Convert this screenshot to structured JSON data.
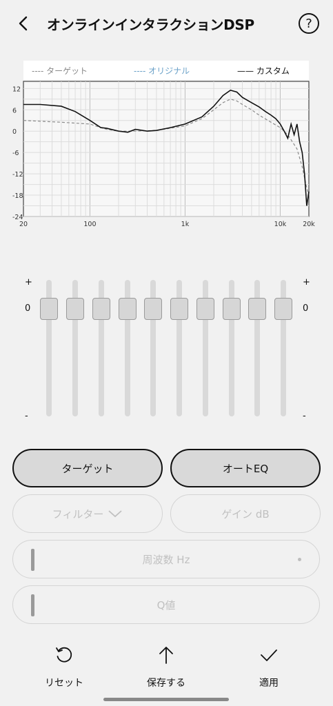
{
  "header": {
    "title": "オンラインインタラクションDSP",
    "help": "?"
  },
  "chart_data": {
    "type": "line",
    "legend": [
      "ターゲット",
      "オリジナル",
      "カスタム"
    ],
    "yticks": [
      "12",
      "6",
      "0",
      "-6",
      "-12",
      "-18",
      "-24"
    ],
    "xticks": [
      "20",
      "100",
      "1k",
      "10k",
      "20k"
    ],
    "ylim": [
      -24,
      14
    ],
    "xlim": [
      20,
      20000
    ],
    "log_x": true,
    "grid": true,
    "colors": {
      "target": "#8a8a8a",
      "original": "#6aa1c8",
      "custom": "#111111"
    },
    "series": [
      {
        "name": "カスタム",
        "x": [
          20,
          30,
          50,
          70,
          100,
          130,
          150,
          200,
          250,
          300,
          400,
          500,
          700,
          1000,
          1500,
          2000,
          2500,
          3000,
          3500,
          4000,
          5000,
          6000,
          7000,
          8000,
          9000,
          10000,
          11000,
          12000,
          13000,
          14000,
          15000,
          16000,
          17000,
          18000,
          19000,
          20000
        ],
        "y": [
          7.5,
          7.5,
          7,
          5.5,
          3,
          1,
          0.8,
          0,
          -0.3,
          0.5,
          0,
          0.2,
          1,
          2,
          4,
          7,
          10,
          11.5,
          11,
          9.5,
          8,
          6.8,
          5.5,
          4.5,
          3.5,
          2,
          0,
          -2,
          2,
          -1,
          2,
          -3,
          -6,
          -12,
          -21,
          -17
        ]
      },
      {
        "name": "ターゲット",
        "x": [
          20,
          50,
          100,
          130,
          150,
          200,
          300,
          500,
          1000,
          1500,
          2000,
          2500,
          3000,
          3500,
          4000,
          5000,
          6000,
          8000,
          10000,
          12000,
          15000,
          17000,
          19000,
          20000
        ],
        "y": [
          3,
          2.5,
          2,
          1,
          0.5,
          0,
          0,
          0.2,
          1.5,
          3.5,
          6,
          8,
          9,
          8.5,
          7.5,
          6,
          4.5,
          2.5,
          1,
          -1,
          -5,
          -10,
          -16,
          -18
        ]
      }
    ]
  },
  "eq": {
    "plus": "+",
    "zero": "0",
    "minus": "-",
    "bands": [
      0,
      0,
      0,
      0,
      0,
      0,
      0,
      0,
      0,
      0
    ]
  },
  "buttons": {
    "target": "ターゲット",
    "auto_eq": "オートEQ",
    "filter": "フィルター",
    "gain": "ゲイン dB",
    "frequency": "周波数 Hz",
    "q": "Q値"
  },
  "bottom": {
    "reset": "リセット",
    "save": "保存する",
    "apply": "適用"
  }
}
